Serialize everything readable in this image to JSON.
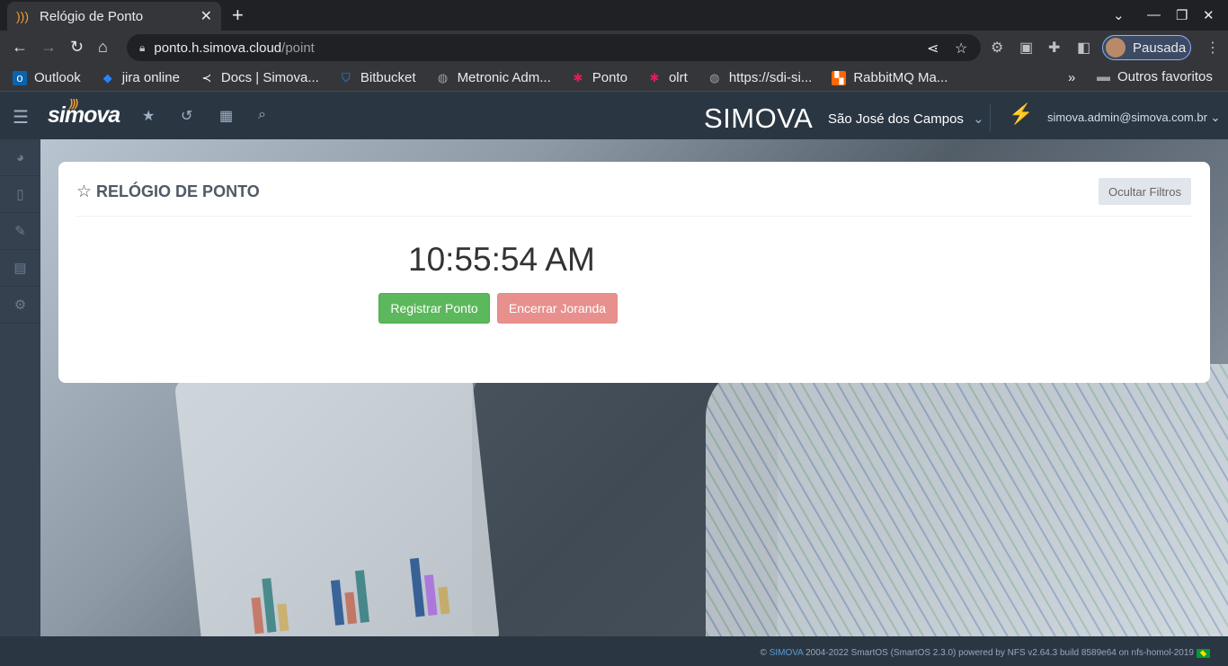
{
  "browser": {
    "tab_title": "Relógio de Ponto",
    "url_host": "ponto.h.simova.cloud",
    "url_path": "/point",
    "profile_label": "Pausada",
    "bookmarks": [
      {
        "label": "Outlook",
        "icon": "outlook-icon",
        "color": "#0a64ad"
      },
      {
        "label": "jira online",
        "icon": "jira-icon",
        "color": "#2684ff"
      },
      {
        "label": "Docs | Simova...",
        "icon": "docs-icon",
        "color": "#ffffff"
      },
      {
        "label": "Bitbucket",
        "icon": "bitbucket-icon",
        "color": "#2684ff"
      },
      {
        "label": "Metronic Adm...",
        "icon": "globe-icon",
        "color": "#9aa0a6"
      },
      {
        "label": "Ponto",
        "icon": "slack-icon",
        "color": "#e01e5a"
      },
      {
        "label": "olrt",
        "icon": "slack-icon",
        "color": "#e01e5a"
      },
      {
        "label": "https://sdi-si...",
        "icon": "globe-icon",
        "color": "#9aa0a6"
      },
      {
        "label": "RabbitMQ Ma...",
        "icon": "rabbitmq-icon",
        "color": "#ff6600"
      }
    ],
    "other_bookmarks": "Outros favoritos"
  },
  "app": {
    "logo": "simova",
    "brand": "SIMOVA",
    "city": "São José dos Campos",
    "user": "simova.admin@simova.com.br",
    "page_title": "RELÓGIO DE PONTO",
    "filter_button": "Ocultar Filtros",
    "clock": "10:55:54 AM",
    "register_button": "Registrar Ponto",
    "end_button": "Encerrar Joranda",
    "footer_prefix": "©",
    "footer_link": "SIMOVA",
    "footer_text": "2004-2022 SmartOS (SmartOS 2.3.0) powered by NFS v2.64.3 build 8589e64 on nfs-homol-2019",
    "accent": "#5cb85c",
    "danger": "#e7908e"
  }
}
